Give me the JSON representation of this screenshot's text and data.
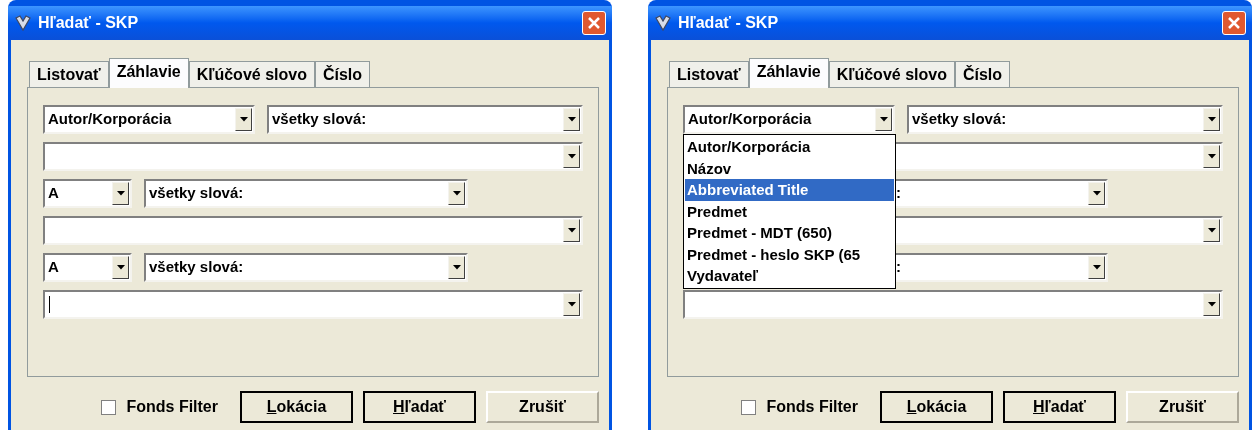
{
  "dialogs": [
    {
      "title": "Hľadať - SKP",
      "tabs": [
        {
          "label": "Listovať",
          "selected": false
        },
        {
          "label": "Záhlavie",
          "selected": true
        },
        {
          "label": "Kľúčové slovo",
          "selected": false
        },
        {
          "label": "Číslo",
          "selected": false
        }
      ],
      "rows": [
        {
          "kind": "wide_pair",
          "left": "Autor/Korporácia",
          "right": "všetky slová:"
        },
        {
          "kind": "full"
        },
        {
          "kind": "narrow_pair",
          "left": "A",
          "right": "všetky slová:"
        },
        {
          "kind": "full"
        },
        {
          "kind": "narrow_pair",
          "left": "A",
          "right": "všetky slová:"
        },
        {
          "kind": "full",
          "focused": true
        }
      ],
      "fonds_filter": {
        "label": "Fonds Filter",
        "checked": false
      },
      "buttons": [
        {
          "label": "Lokácia",
          "mnemonic": true,
          "emphasized": true
        },
        {
          "label": "Hľadať",
          "mnemonic": true,
          "emphasized": true
        },
        {
          "label": "Zrušiť",
          "mnemonic": false,
          "emphasized": false
        }
      ]
    },
    {
      "title": "Hľadať - SKP",
      "tabs": [
        {
          "label": "Listovať",
          "selected": false
        },
        {
          "label": "Záhlavie",
          "selected": true
        },
        {
          "label": "Kľúčové slovo",
          "selected": false
        },
        {
          "label": "Číslo",
          "selected": false
        }
      ],
      "rows": [
        {
          "kind": "wide_pair",
          "left": "Autor/Korporácia",
          "right": "všetky slová:",
          "dropdown": [
            {
              "label": "Autor/Korporácia",
              "selected": false
            },
            {
              "label": "Názov",
              "selected": false
            },
            {
              "label": "Abbreviated Title",
              "selected": true
            },
            {
              "label": "Predmet",
              "selected": false
            },
            {
              "label": "Predmet - MDT (650)",
              "selected": false
            },
            {
              "label": "Predmet - heslo SKP (65",
              "selected": false
            },
            {
              "label": "Vydavateľ",
              "selected": false
            }
          ]
        },
        {
          "kind": "full"
        },
        {
          "kind": "narrow_pair",
          "right": ":",
          "right_covered": true
        },
        {
          "kind": "full"
        },
        {
          "kind": "narrow_pair",
          "right": ":",
          "right_covered": true
        },
        {
          "kind": "full"
        }
      ],
      "fonds_filter": {
        "label": "Fonds Filter",
        "checked": false
      },
      "buttons": [
        {
          "label": "Lokácia",
          "mnemonic": true,
          "emphasized": true
        },
        {
          "label": "Hľadať",
          "mnemonic": true,
          "emphasized": true
        },
        {
          "label": "Zrušiť",
          "mnemonic": false,
          "emphasized": false
        }
      ]
    }
  ]
}
